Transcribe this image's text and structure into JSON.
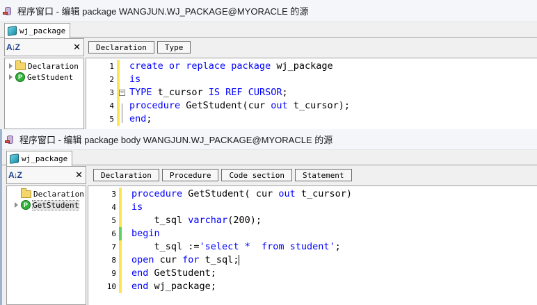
{
  "window1": {
    "title": "程序窗口 - 编辑 package WANGJUN.WJ_PACKAGE@MYORACLE 的源",
    "tab_label": "wj_package",
    "tree": [
      {
        "label": "Declaration",
        "icon": "folder-icon"
      },
      {
        "label": "GetStudent",
        "icon": "procedure-icon",
        "icon_glyph": "P"
      }
    ],
    "toolbar_buttons": [
      "Declaration",
      "Type"
    ],
    "lines": [
      {
        "n": "1",
        "parts": [
          {
            "t": "create or replace package",
            "k": true
          },
          {
            "t": " wj_package"
          }
        ]
      },
      {
        "n": "2",
        "parts": [
          {
            "t": "is",
            "k": true
          }
        ]
      },
      {
        "n": "3",
        "parts": [
          {
            "t": "TYPE",
            "k": true
          },
          {
            "t": " t_cursor "
          },
          {
            "t": "IS REF CURSOR",
            "k": true
          },
          {
            "t": ";"
          }
        ]
      },
      {
        "n": "4",
        "parts": [
          {
            "t": "procedure",
            "k": true
          },
          {
            "t": " GetStudent(cur "
          },
          {
            "t": "out",
            "k": true
          },
          {
            "t": " t_cursor);"
          }
        ]
      },
      {
        "n": "5",
        "parts": [
          {
            "t": "end",
            "k": true
          },
          {
            "t": ";"
          }
        ]
      }
    ]
  },
  "window2": {
    "title": "程序窗口 - 编辑 package body WANGJUN.WJ_PACKAGE@MYORACLE 的源",
    "tab_label": "wj_package",
    "tree": [
      {
        "label": "Declaration",
        "icon": "folder-icon"
      },
      {
        "label": "GetStudent",
        "icon": "procedure-icon",
        "icon_glyph": "P"
      }
    ],
    "toolbar_buttons": [
      "Declaration",
      "Procedure",
      "Code section",
      "Statement"
    ],
    "lines": [
      {
        "n": "3",
        "parts": [
          {
            "t": "procedure",
            "k": true
          },
          {
            "t": " GetStudent( cur "
          },
          {
            "t": "out",
            "k": true
          },
          {
            "t": " t_cursor)"
          }
        ]
      },
      {
        "n": "4",
        "parts": [
          {
            "t": "is",
            "k": true
          }
        ]
      },
      {
        "n": "5",
        "parts": [
          {
            "t": "    t_sql "
          },
          {
            "t": "varchar",
            "k": true
          },
          {
            "t": "(200);"
          }
        ]
      },
      {
        "n": "6",
        "parts": [
          {
            "t": "begin",
            "k": true
          }
        ]
      },
      {
        "n": "7",
        "parts": [
          {
            "t": "    t_sql :="
          },
          {
            "t": "'select *  from student'",
            "k": true
          },
          {
            "t": ";"
          }
        ]
      },
      {
        "n": "8",
        "parts": [
          {
            "t": "open",
            "k": true
          },
          {
            "t": " cur "
          },
          {
            "t": "for",
            "k": true
          },
          {
            "t": " t_sql;"
          }
        ]
      },
      {
        "n": "9",
        "parts": [
          {
            "t": "end",
            "k": true
          },
          {
            "t": " GetStudent;"
          }
        ]
      },
      {
        "n": "10",
        "parts": [
          {
            "t": "end",
            "k": true
          },
          {
            "t": " wj_package;"
          }
        ]
      }
    ]
  },
  "colors": {
    "keyword": "#0000ff",
    "changed_marker": "#ffe44d",
    "saved_marker": "#5fd35f"
  }
}
